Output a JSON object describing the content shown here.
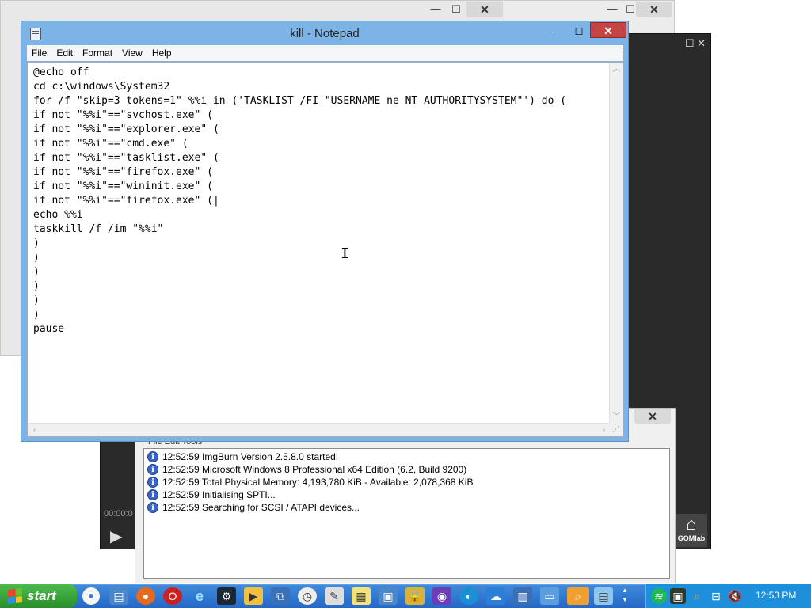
{
  "notepad": {
    "title": "kill - Notepad",
    "minimize": "—",
    "maximize": "☐",
    "close": "✕",
    "menu": [
      "File",
      "Edit",
      "Format",
      "View",
      "Help"
    ],
    "lines": [
      "@echo off",
      "cd c:\\windows\\System32",
      "for /f \"skip=3 tokens=1\" %%i in ('TASKLIST /FI \"USERNAME ne NT AUTHORITYSYSTEM\"') do (",
      "if not \"%%i\"==\"svchost.exe\" (",
      "if not \"%%i\"==\"explorer.exe\" (",
      "if not \"%%i\"==\"cmd.exe\" (",
      "if not \"%%i\"==\"tasklist.exe\" (",
      "if not \"%%i\"==\"firefox.exe\" (",
      "if not \"%%i\"==\"wininit.exe\" (",
      "if not \"%%i\"==\"firefox.exe\" (|",
      "echo %%i",
      "taskkill /f /im \"%%i\"",
      ")",
      ")",
      ")",
      ")",
      ")",
      ")",
      "pause"
    ]
  },
  "imgburn": {
    "menu_partial": "File   Edit   Tools",
    "log": [
      "12:52:59 ImgBurn Version 2.5.8.0 started!",
      "12:52:59 Microsoft Windows 8 Professional x64 Edition (6.2, Build 9200)",
      "12:52:59 Total Physical Memory: 4,193,780 KiB  -  Available: 2,078,368 KiB",
      "12:52:59 Initialising SPTI...",
      "12:52:59 Searching for SCSI / ATAPI devices..."
    ]
  },
  "gom": {
    "time": "00:00:0",
    "home_label": "GOMlab"
  },
  "taskbar": {
    "start_label": "start",
    "clock": "12:53 PM",
    "icons": [
      "chrome-icon",
      "file-explorer-icon",
      "firefox-icon",
      "opera-icon",
      "internet-explorer-icon",
      "steam-icon",
      "media-player-icon",
      "window-switcher-icon",
      "clock-icon",
      "paint-icon",
      "sticky-notes-icon",
      "explorer-icon",
      "padlock-icon",
      "video-editor-icon",
      "edge-icon",
      "cloud-icon",
      "calculator-icon",
      "card-icon",
      "search-magnifier-icon",
      "notepad-icon"
    ],
    "tray_icons": [
      "spotify-icon",
      "tray-app-icon",
      "search-icon",
      "network-icon",
      "volume-mute-icon"
    ]
  }
}
